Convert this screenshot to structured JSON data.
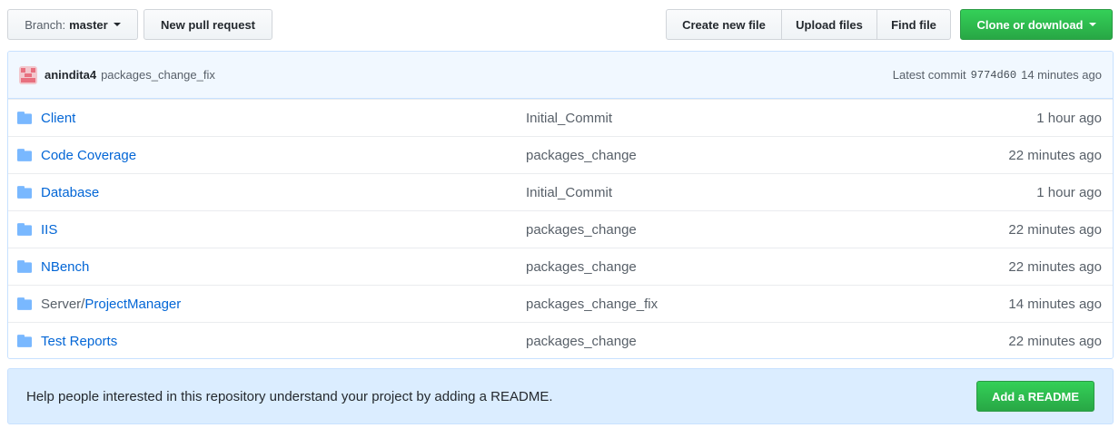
{
  "toolbar": {
    "branch_prefix": "Branch:",
    "branch_name": "master",
    "new_pr_label": "New pull request",
    "create_file_label": "Create new file",
    "upload_label": "Upload files",
    "find_label": "Find file",
    "clone_label": "Clone or download"
  },
  "commit": {
    "author": "anindita4",
    "message": "packages_change_fix",
    "latest_label": "Latest commit",
    "sha": "9774d60",
    "age": "14 minutes ago"
  },
  "files": [
    {
      "name": "Client",
      "message": "Initial_Commit",
      "age": "1 hour ago"
    },
    {
      "name": "Code Coverage",
      "message": "packages_change",
      "age": "22 minutes ago"
    },
    {
      "name": "Database",
      "message": "Initial_Commit",
      "age": "1 hour ago"
    },
    {
      "name": "IIS",
      "message": "packages_change",
      "age": "22 minutes ago"
    },
    {
      "name": "NBench",
      "message": "packages_change",
      "age": "22 minutes ago"
    },
    {
      "name_prefix": "Server/",
      "name": "ProjectManager",
      "message": "packages_change_fix",
      "age": "14 minutes ago"
    },
    {
      "name": "Test Reports",
      "message": "packages_change",
      "age": "22 minutes ago"
    }
  ],
  "readme": {
    "text": "Help people interested in this repository understand your project by adding a README.",
    "button_label": "Add a README"
  },
  "colors": {
    "link": "#0366d6",
    "green": "#28a745",
    "folder": "#79b8ff",
    "commit_bg": "#f1f8ff",
    "readme_bg": "#dbedff"
  },
  "icons": {
    "folder": "folder-icon",
    "caret": "caret-down-icon",
    "avatar": "avatar"
  }
}
